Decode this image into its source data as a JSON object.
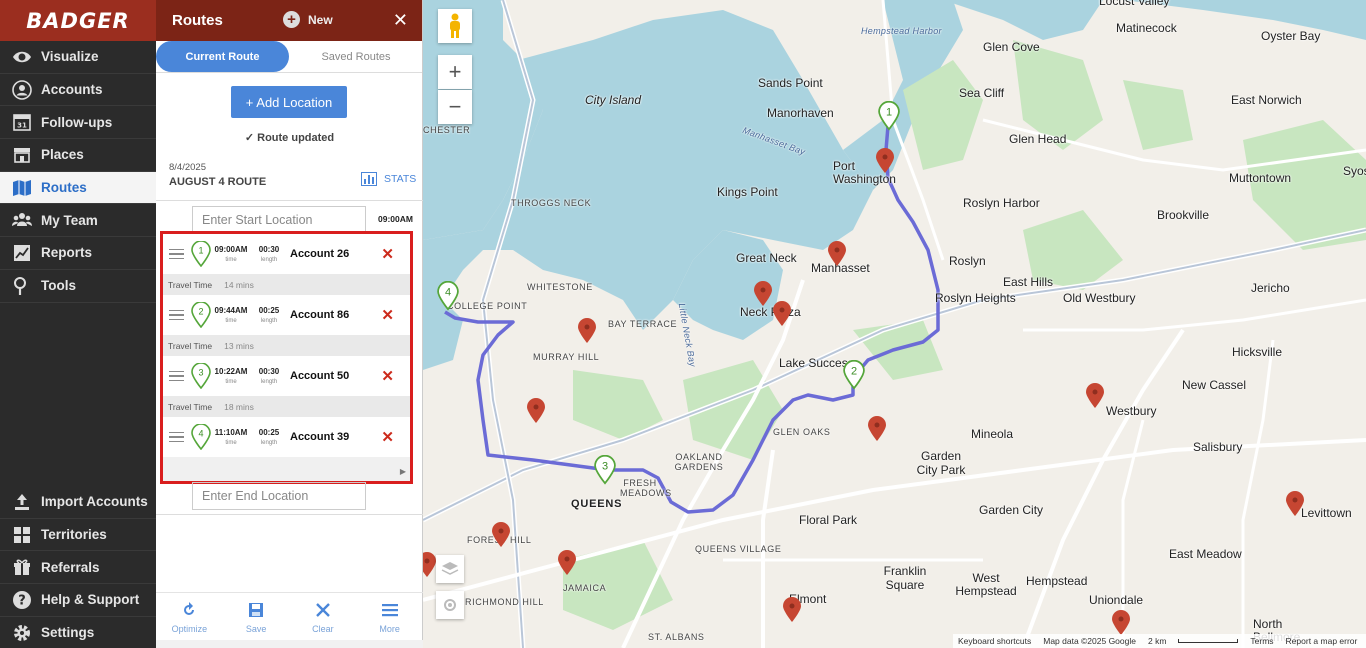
{
  "brand": {
    "logo_text": "BADGER",
    "accent": "#4a86d9",
    "header_color": "#7c2416"
  },
  "nav": {
    "items": [
      {
        "label": "Visualize",
        "icon": "eye-icon"
      },
      {
        "label": "Accounts",
        "icon": "user-icon"
      },
      {
        "label": "Follow-ups",
        "icon": "calendar-icon"
      },
      {
        "label": "Places",
        "icon": "store-icon"
      },
      {
        "label": "Routes",
        "icon": "map-icon",
        "active": true
      },
      {
        "label": "My Team",
        "icon": "team-icon"
      },
      {
        "label": "Reports",
        "icon": "report-icon"
      },
      {
        "label": "Tools",
        "icon": "tools-icon"
      }
    ],
    "bottom_items": [
      {
        "label": "Import Accounts",
        "icon": "upload-icon"
      },
      {
        "label": "Territories",
        "icon": "grid-icon"
      },
      {
        "label": "Referrals",
        "icon": "gift-icon"
      },
      {
        "label": "Help & Support",
        "icon": "help-icon"
      },
      {
        "label": "Settings",
        "icon": "gear-icon"
      }
    ]
  },
  "panel": {
    "title": "Routes",
    "new_label": "New",
    "tabs": {
      "current": "Current Route",
      "saved": "Saved Routes"
    },
    "add_location": "+ Add Location",
    "status": "Route updated",
    "route_date": "8/4/2025",
    "route_name": "AUGUST 4 ROUTE",
    "stats_label": "STATS",
    "start_placeholder": "Enter Start Location",
    "start_time": "09:00AM",
    "end_placeholder": "Enter End Location",
    "time_caption": "time",
    "length_caption": "length",
    "travel_label": "Travel Time",
    "stops": [
      {
        "num": "1",
        "time": "09:00AM",
        "length": "00:30",
        "name": "Account 26"
      },
      {
        "num": "2",
        "time": "09:44AM",
        "length": "00:25",
        "name": "Account 86"
      },
      {
        "num": "3",
        "time": "10:22AM",
        "length": "00:30",
        "name": "Account 50"
      },
      {
        "num": "4",
        "time": "11:10AM",
        "length": "00:25",
        "name": "Account 39"
      }
    ],
    "travel_times": [
      "14 mins",
      "13 mins",
      "18 mins"
    ],
    "toolbar": {
      "optimize": "Optimize",
      "save": "Save",
      "clear": "Clear",
      "more": "More"
    }
  },
  "map": {
    "places": [
      "Locust Valley",
      "Matinecock",
      "Oyster Bay",
      "Hempstead Harbor",
      "Glen Cove",
      "Sands Point",
      "City Island",
      "Sea Cliff",
      "East Norwich",
      "Manorhaven",
      "Glen Head",
      "Port Washington",
      "Manhasset Bay",
      "Muttontown",
      "Syosset",
      "Kings Point",
      "Roslyn Harbor",
      "Brookville",
      "THROGGS NECK",
      "Great Neck",
      "Manhasset",
      "Roslyn",
      "East Hills",
      "Jericho",
      "WHITESTONE",
      "Neck Plaza",
      "Roslyn Heights",
      "Old Westbury",
      "COLLEGE POINT",
      "BAY TERRACE",
      "Little Neck Bay",
      "Lake Success",
      "Hicksville",
      "MURRAY HILL",
      "New Cassel",
      "Westbury",
      "New Cassel",
      "GLEN OAKS",
      "Mineola",
      "Salisbury",
      "OAKLAND GARDENS",
      "Garden City Park",
      "FRESH MEADOWS",
      "QUEENS",
      "Floral Park",
      "Garden City",
      "Levittown",
      "FOREST HILL",
      "QUEENS VILLAGE",
      "East Meadow",
      "JAMAICA",
      "Franklin Square",
      "West Hempstead",
      "Hempstead",
      "RICHMOND HILL",
      "Elmont",
      "Uniondale",
      "ST. ALBANS",
      "North Bellmore",
      "CHESTER"
    ],
    "footer": {
      "shortcuts": "Keyboard shortcuts",
      "data": "Map data ©2025 Google",
      "scale": "2 km",
      "terms": "Terms",
      "report": "Report a map error"
    }
  }
}
